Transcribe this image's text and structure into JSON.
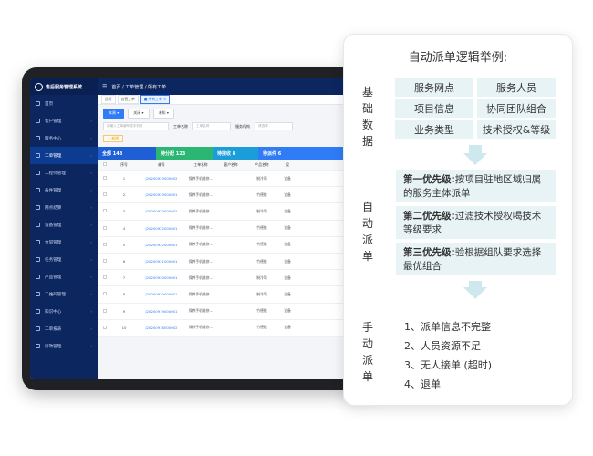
{
  "app": {
    "title": "售后服务管理系统",
    "breadcrumb": "首页 / 工单管理 / 所有工单",
    "hamburger": "☰"
  },
  "sidebar": {
    "items": [
      {
        "label": "首页",
        "icon": "home-icon"
      },
      {
        "label": "客户管理",
        "icon": "customer-icon"
      },
      {
        "label": "服务中心",
        "icon": "service-icon"
      },
      {
        "label": "工单管理",
        "icon": "ticket-icon"
      },
      {
        "label": "工程师管理",
        "icon": "engineer-icon"
      },
      {
        "label": "备件管理",
        "icon": "parts-icon"
      },
      {
        "label": "网点结算",
        "icon": "settlement-icon"
      },
      {
        "label": "设备管理",
        "icon": "device-icon"
      },
      {
        "label": "合同管理",
        "icon": "contract-icon"
      },
      {
        "label": "任务管理",
        "icon": "task-icon"
      },
      {
        "label": "产品管理",
        "icon": "product-icon"
      },
      {
        "label": "二维码管理",
        "icon": "qrcode-icon"
      },
      {
        "label": "知识中心",
        "icon": "knowledge-icon"
      },
      {
        "label": "工单报表",
        "icon": "report-icon"
      },
      {
        "label": "行政管理",
        "icon": "admin-icon"
      }
    ]
  },
  "tabs": [
    {
      "label": "首页"
    },
    {
      "label": "自营工单"
    },
    {
      "label": "■ 所有工单 ×"
    }
  ],
  "filters": {
    "time_label": "本周",
    "b2_label": "关闭",
    "b3_label": "未知"
  },
  "search": {
    "placeholder1": "请输入工单编号或手机号",
    "label2": "工单名称",
    "placeholder2": "工单名称",
    "label3": "服务机构",
    "placeholder3": "请选择"
  },
  "add_button": "+ 新增",
  "stats": [
    {
      "label": "全部  148",
      "color": "#1e5fd6"
    },
    {
      "label": "待分配  123",
      "color": "#2bb673"
    },
    {
      "label": "待接收  8",
      "color": "#1a9dd9"
    },
    {
      "label": "待派件  6",
      "color": "#2f7cf6"
    }
  ],
  "table": {
    "headers": [
      "",
      "序号",
      "编号",
      "工单名称",
      "客户名称",
      "产品名称",
      "设"
    ],
    "rows": [
      {
        "idx": "1",
        "code": "J20200923000002",
        "name": "保养手机维修...",
        "customer": "",
        "product": "制冷项",
        "extra": "设备"
      },
      {
        "idx": "2",
        "code": "J20200923000001",
        "name": "保养手机维修...",
        "customer": "",
        "product": "竹德能",
        "extra": "设备"
      },
      {
        "idx": "3",
        "code": "J20200923000002",
        "name": "保养手机维修...",
        "customer": "",
        "product": "制冷项",
        "extra": "设备"
      },
      {
        "idx": "4",
        "code": "J20200922000001",
        "name": "保养手机维修...",
        "customer": "",
        "product": "竹德能",
        "extra": "设备"
      },
      {
        "idx": "5",
        "code": "J20200922000001",
        "name": "保养手机维修...",
        "customer": "",
        "product": "竹德能",
        "extra": "设备"
      },
      {
        "idx": "6",
        "code": "J20200921000001",
        "name": "保养手机维修...",
        "customer": "",
        "product": "竹德能",
        "extra": "设备"
      },
      {
        "idx": "7",
        "code": "J20200920000001",
        "name": "保养手机维修...",
        "customer": "",
        "product": "制冷项",
        "extra": "设备"
      },
      {
        "idx": "8",
        "code": "J20200920000001",
        "name": "保养手机维修...",
        "customer": "",
        "product": "制冷项",
        "extra": "设备"
      },
      {
        "idx": "9",
        "code": "J20200919000001",
        "name": "保养手机维修...",
        "customer": "",
        "product": "竹德能",
        "extra": "设备"
      },
      {
        "idx": "10",
        "code": "J20200918000002",
        "name": "保养手机维修...",
        "customer": "",
        "product": "竹德能",
        "extra": "设备"
      }
    ]
  },
  "card": {
    "title": "自动派单逻辑举例:",
    "basic_label": [
      "基",
      "础",
      "数",
      "据"
    ],
    "basic_items": [
      "服务网点",
      "服务人员",
      "项目信息",
      "协同团队组合",
      "业务类型",
      "技术授权&等级"
    ],
    "auto_label": [
      "自",
      "动",
      "派",
      "单"
    ],
    "priorities": [
      {
        "key": "第一优先级:",
        "text": "按项目驻地区域归属的服务主体派单"
      },
      {
        "key": "第二优先级:",
        "text": "过滤技术授权喝技术等级要求"
      },
      {
        "key": "第三优先级:",
        "text": "验根据组队要求选择最优组合"
      }
    ],
    "manual_label": [
      "手",
      "动",
      "派",
      "单"
    ],
    "manual_items": [
      "1、派单信息不完整",
      "2、人员资源不足",
      "3、无人接单 (超时)",
      "4、退单"
    ]
  }
}
